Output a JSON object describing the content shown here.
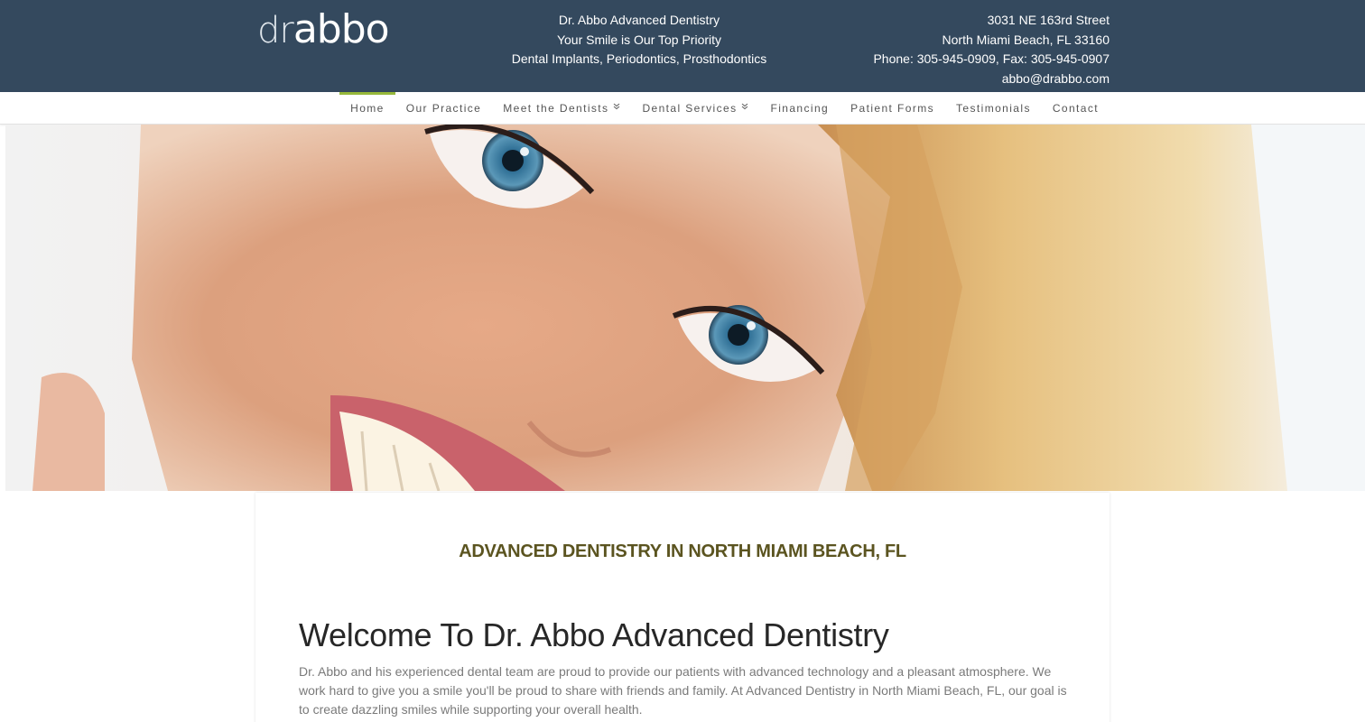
{
  "header": {
    "logo": {
      "dr": "dr",
      "abbo": "abbo"
    },
    "tagline_lines": [
      "Dr. Abbo Advanced Dentistry",
      "Your Smile is Our Top Priority",
      "Dental Implants, Periodontics, Prosthodontics"
    ],
    "address_line1": "3031 NE 163rd Street",
    "address_line2": "North Miami Beach, FL 33160",
    "phone_fax": "Phone: 305-945-0909, Fax: 305-945-0907",
    "email": "abbo@drabbo.com"
  },
  "nav": {
    "items": [
      {
        "label": "Home",
        "active": true,
        "has_dropdown": false
      },
      {
        "label": "Our Practice",
        "active": false,
        "has_dropdown": false
      },
      {
        "label": "Meet the Dentists",
        "active": false,
        "has_dropdown": true
      },
      {
        "label": "Dental Services",
        "active": false,
        "has_dropdown": true
      },
      {
        "label": "Financing",
        "active": false,
        "has_dropdown": false
      },
      {
        "label": "Patient Forms",
        "active": false,
        "has_dropdown": false
      },
      {
        "label": "Testimonials",
        "active": false,
        "has_dropdown": false
      },
      {
        "label": "Contact",
        "active": false,
        "has_dropdown": false
      }
    ],
    "dropdown_glyph": "»"
  },
  "content": {
    "eyebrow": "ADVANCED DENTISTRY IN NORTH MIAMI BEACH, FL",
    "heading": "Welcome To Dr. Abbo Advanced Dentistry",
    "paragraph": "Dr. Abbo and his experienced dental team are proud to provide our patients with advanced technology and a pleasant atmosphere. We work hard to give you a smile you'll be proud to share with friends and family. At Advanced Dentistry in North Miami Beach, FL, our goal is to create dazzling smiles while supporting your overall health."
  },
  "colors": {
    "header_bg": "#34495e",
    "nav_active_accent": "#96b83a",
    "eyebrow_text": "#5b5420"
  }
}
